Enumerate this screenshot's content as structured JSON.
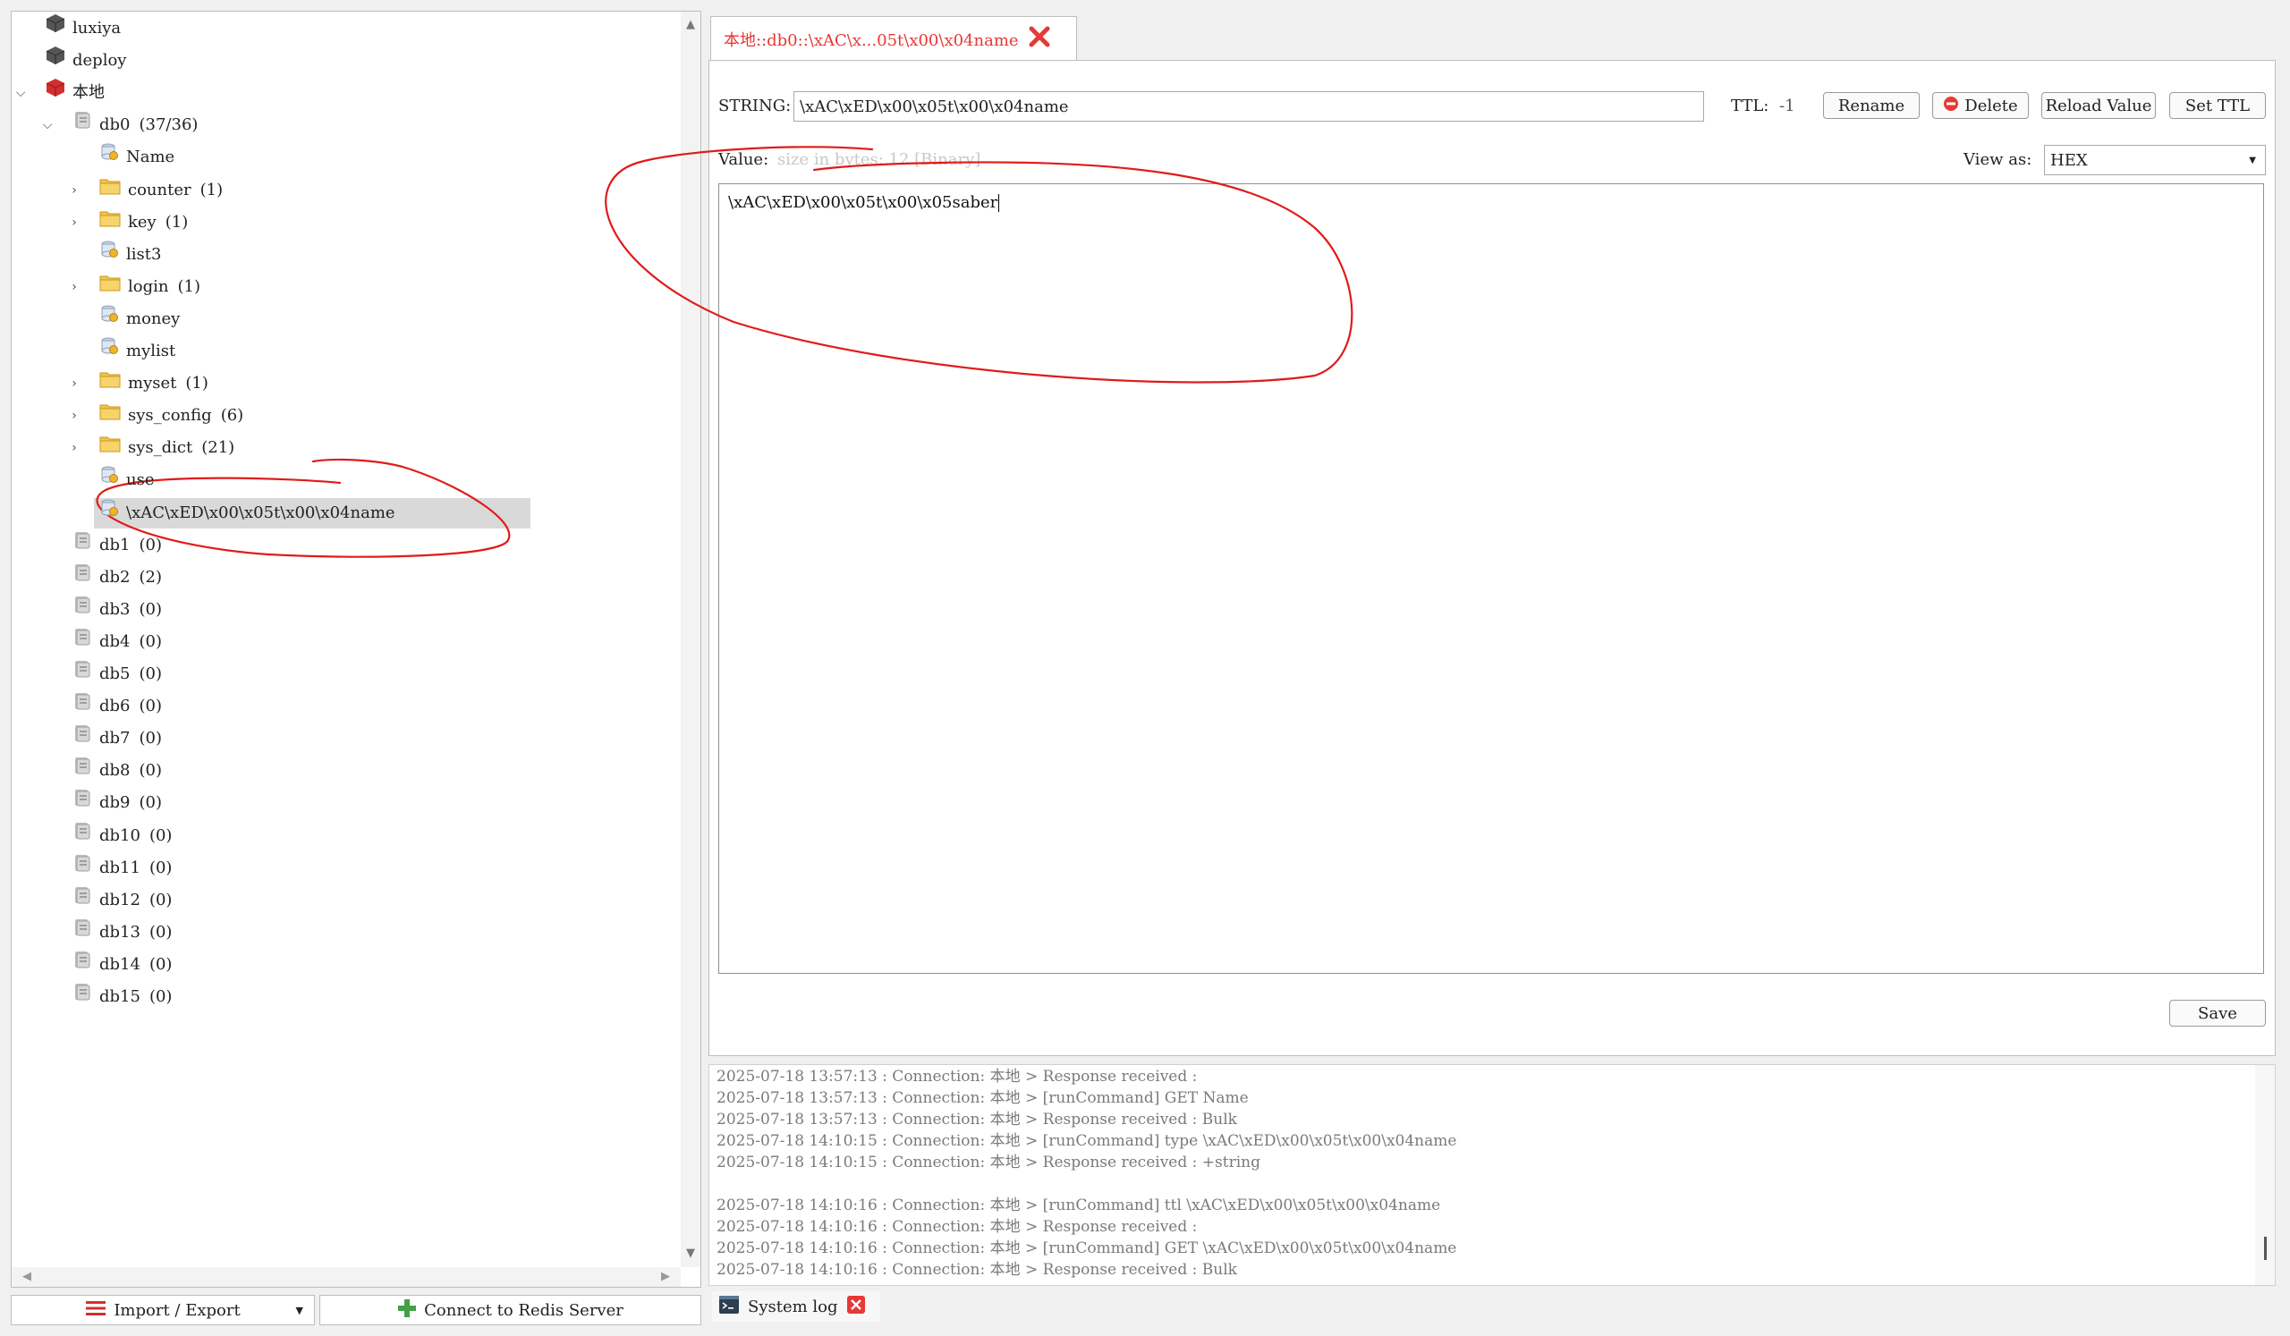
{
  "tree": {
    "servers": [
      {
        "label": "luxiya"
      },
      {
        "label": "deploy"
      },
      {
        "label": "本地"
      }
    ],
    "db0": {
      "label": "db0",
      "count": "(37/36)"
    },
    "keys": [
      {
        "label": "Name",
        "type": "key",
        "count": ""
      },
      {
        "label": "counter",
        "type": "folder",
        "count": "(1)"
      },
      {
        "label": "key",
        "type": "folder",
        "count": "(1)"
      },
      {
        "label": "list3",
        "type": "key",
        "count": ""
      },
      {
        "label": "login",
        "type": "folder",
        "count": "(1)"
      },
      {
        "label": "money",
        "type": "key",
        "count": ""
      },
      {
        "label": "mylist",
        "type": "key",
        "count": ""
      },
      {
        "label": "myset",
        "type": "folder",
        "count": "(1)"
      },
      {
        "label": "sys_config",
        "type": "folder",
        "count": "(6)"
      },
      {
        "label": "sys_dict",
        "type": "folder",
        "count": "(21)"
      },
      {
        "label": "use",
        "type": "key",
        "count": ""
      },
      {
        "label": "\\xAC\\xED\\x00\\x05t\\x00\\x04name",
        "type": "key",
        "count": "",
        "selected": true
      }
    ],
    "dbs": [
      {
        "label": "db1",
        "count": "(0)"
      },
      {
        "label": "db2",
        "count": "(2)"
      },
      {
        "label": "db3",
        "count": "(0)"
      },
      {
        "label": "db4",
        "count": "(0)"
      },
      {
        "label": "db5",
        "count": "(0)"
      },
      {
        "label": "db6",
        "count": "(0)"
      },
      {
        "label": "db7",
        "count": "(0)"
      },
      {
        "label": "db8",
        "count": "(0)"
      },
      {
        "label": "db9",
        "count": "(0)"
      },
      {
        "label": "db10",
        "count": "(0)"
      },
      {
        "label": "db11",
        "count": "(0)"
      },
      {
        "label": "db12",
        "count": "(0)"
      },
      {
        "label": "db13",
        "count": "(0)"
      },
      {
        "label": "db14",
        "count": "(0)"
      },
      {
        "label": "db15",
        "count": "(0)"
      }
    ]
  },
  "bottom_left": {
    "import_export": "Import / Export",
    "connect": "Connect to Redis Server"
  },
  "tab": {
    "title": "本地::db0::\\xAC\\x...05t\\x00\\x04name"
  },
  "editor": {
    "type_label": "STRING:",
    "key_name": "\\xAC\\xED\\x00\\x05t\\x00\\x04name",
    "ttl_label": "TTL:",
    "ttl_value": "-1",
    "rename": "Rename",
    "delete": "Delete",
    "reload": "Reload Value",
    "set_ttl": "Set TTL",
    "value_label": "Value:",
    "value_meta": "size in bytes: 12 [Binary]",
    "view_as_label": "View as:",
    "view_as_value": "HEX",
    "value_text": "\\xAC\\xED\\x00\\x05t\\x00\\x05saber",
    "save": "Save"
  },
  "log": {
    "lines": [
      "2025-07-18 13:57:13 : Connection: 本地 > Response received :",
      "2025-07-18 13:57:13 : Connection: 本地 > [runCommand] GET Name",
      "2025-07-18 13:57:13 : Connection: 本地 > Response received : Bulk",
      "2025-07-18 14:10:15 : Connection: 本地 > [runCommand] type \\xAC\\xED\\x00\\x05t\\x00\\x04name",
      "2025-07-18 14:10:15 : Connection: 本地 > Response received : +string",
      "",
      "2025-07-18 14:10:16 : Connection: 本地 > [runCommand] ttl \\xAC\\xED\\x00\\x05t\\x00\\x04name",
      "2025-07-18 14:10:16 : Connection: 本地 > Response received :",
      "2025-07-18 14:10:16 : Connection: 本地 > [runCommand] GET \\xAC\\xED\\x00\\x05t\\x00\\x04name",
      "2025-07-18 14:10:16 : Connection: 本地 > Response received : Bulk"
    ],
    "system_log_tab": "System log"
  },
  "colors": {
    "accent_red": "#e53935",
    "annotation_red": "#e01b1b",
    "folder_yellow": "#f3c44a",
    "selected_bg": "#d9d9d9"
  }
}
